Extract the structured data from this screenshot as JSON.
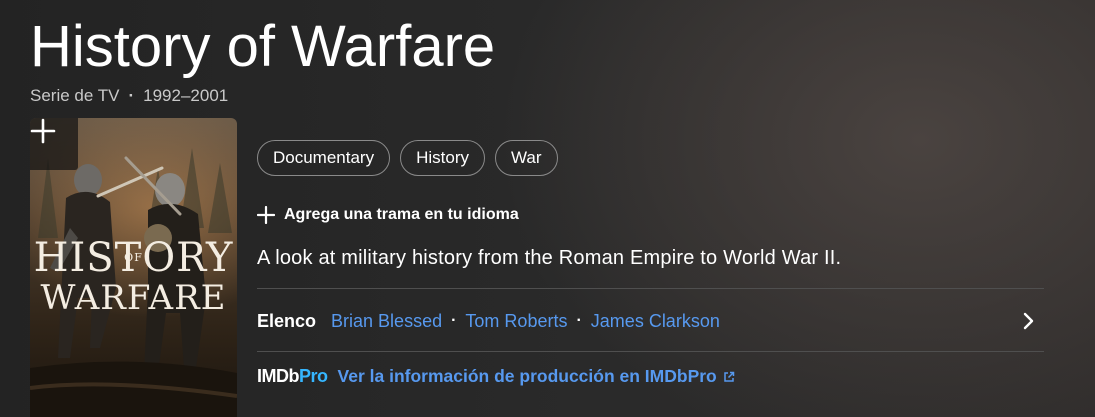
{
  "title": "History of Warfare",
  "meta": {
    "type": "Serie de TV",
    "years": "1992–2001"
  },
  "poster": {
    "line1": "HISTORY",
    "of": "OF",
    "line2": "WARFARE"
  },
  "genres": [
    "Documentary",
    "History",
    "War"
  ],
  "plot_add_label": "Agrega una trama en tu idioma",
  "plot": "A look at military history from the Roman Empire to World War II.",
  "cast": {
    "label": "Elenco",
    "members": [
      "Brian Blessed",
      "Tom Roberts",
      "James Clarkson"
    ]
  },
  "imdbpro": {
    "logo_imdb": "IMDb",
    "logo_pro": "Pro",
    "link": "Ver la información de producción en IMDbPro"
  },
  "icons": [
    "plus-icon",
    "chevron-right-icon",
    "external-link-icon"
  ],
  "colors": {
    "link": "#5799ef",
    "pro": "#35b6ff",
    "background": "#262626"
  }
}
